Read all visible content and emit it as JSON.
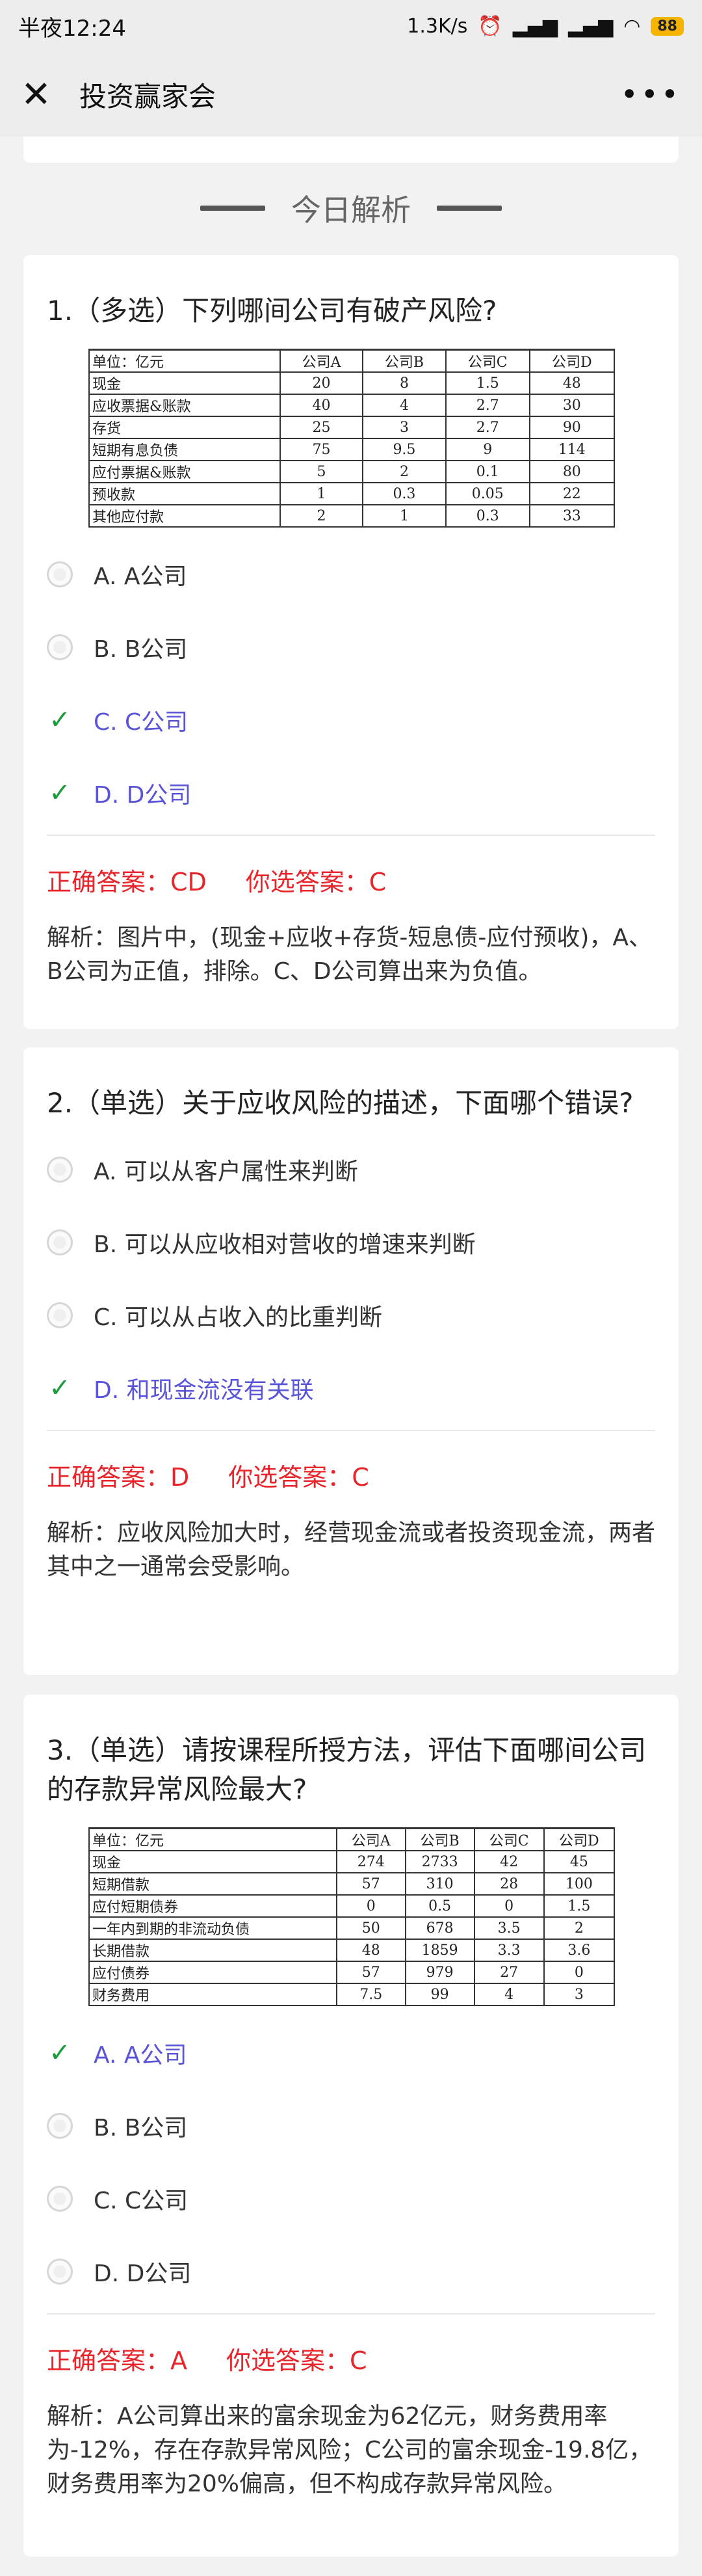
{
  "status": {
    "time": "半夜12:24",
    "net": "1.3K/s",
    "battery": "88"
  },
  "nav": {
    "title": "投资赢家会"
  },
  "section": {
    "title": "今日解析"
  },
  "questions": [
    {
      "text": "1.（多选）下列哪间公司有破产风险?",
      "table": {
        "header": [
          "单位：亿元",
          "公司A",
          "公司B",
          "公司C",
          "公司D"
        ],
        "rows": [
          [
            "现金",
            "20",
            "8",
            "1.5",
            "48"
          ],
          [
            "应收票据&账款",
            "40",
            "4",
            "2.7",
            "30"
          ],
          [
            "存货",
            "25",
            "3",
            "2.7",
            "90"
          ],
          [
            "短期有息负债",
            "75",
            "9.5",
            "9",
            "114"
          ],
          [
            "应付票据&账款",
            "5",
            "2",
            "0.1",
            "80"
          ],
          [
            "预收款",
            "1",
            "0.3",
            "0.05",
            "22"
          ],
          [
            "其他应付款",
            "2",
            "1",
            "0.3",
            "33"
          ]
        ]
      },
      "options": [
        {
          "label": "A. A公司",
          "selected": false
        },
        {
          "label": "B. B公司",
          "selected": false
        },
        {
          "label": "C. C公司",
          "selected": true
        },
        {
          "label": "D. D公司",
          "selected": true
        }
      ],
      "correct": "正确答案：CD",
      "yours": "你选答案：C",
      "explain": "解析：图片中，(现金+应收+存货-短息债-应付预收)，A、B公司为正值，排除。C、D公司算出来为负值。"
    },
    {
      "text": "2.（单选）关于应收风险的描述，下面哪个错误?",
      "options": [
        {
          "label": "A. 可以从客户属性来判断",
          "selected": false
        },
        {
          "label": "B. 可以从应收相对营收的增速来判断",
          "selected": false
        },
        {
          "label": "C. 可以从占收入的比重判断",
          "selected": false
        },
        {
          "label": "D. 和现金流没有关联",
          "selected": true
        }
      ],
      "correct": "正确答案：D",
      "yours": "你选答案：C",
      "explain": "解析：应收风险加大时，经营现金流或者投资现金流，两者其中之一通常会受影响。"
    },
    {
      "text": "3.（单选）请按课程所授方法，评估下面哪间公司的存款异常风险最大?",
      "table": {
        "header": [
          "单位：亿元",
          "公司A",
          "公司B",
          "公司C",
          "公司D"
        ],
        "rows": [
          [
            "现金",
            "274",
            "2733",
            "42",
            "45"
          ],
          [
            "短期借款",
            "57",
            "310",
            "28",
            "100"
          ],
          [
            "应付短期债券",
            "0",
            "0.5",
            "0",
            "1.5"
          ],
          [
            "一年内到期的非流动负债",
            "50",
            "678",
            "3.5",
            "2"
          ],
          [
            "长期借款",
            "48",
            "1859",
            "3.3",
            "3.6"
          ],
          [
            "应付债券",
            "57",
            "979",
            "27",
            "0"
          ],
          [
            "财务费用",
            "7.5",
            "99",
            "4",
            "3"
          ]
        ]
      },
      "options": [
        {
          "label": "A. A公司",
          "selected": true
        },
        {
          "label": "B. B公司",
          "selected": false
        },
        {
          "label": "C. C公司",
          "selected": false
        },
        {
          "label": "D. D公司",
          "selected": false
        }
      ],
      "correct": "正确答案：A",
      "yours": "你选答案：C",
      "explain": "解析：A公司算出来的富余现金为62亿元，财务费用率为-12%，存在存款异常风险；C公司的富余现金-19.8亿，财务费用率为20%偏高，但不构成存款异常风险。"
    }
  ]
}
